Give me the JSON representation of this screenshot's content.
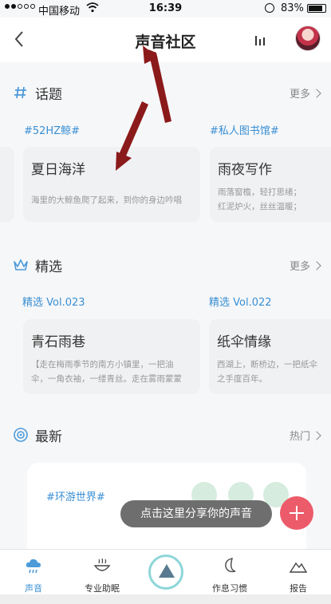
{
  "status_bar": {
    "carrier": "中国移动",
    "time": "16:39",
    "battery": "83%"
  },
  "nav": {
    "title": "声音社区"
  },
  "topics": {
    "title": "话题",
    "more": "更多",
    "cards": [
      {
        "tag": "#52HZ鲸#",
        "title": "夏日海洋",
        "desc": "海里的大鲸鱼爬了起来，到你的身边吟唱"
      },
      {
        "tag": "#私人图书馆#",
        "title": "雨夜写作",
        "desc_lines": [
          "雨落窗檐，轻打思绪；",
          "红泥炉火，丝丝温暖；"
        ]
      }
    ]
  },
  "featured": {
    "title": "精选",
    "more": "更多",
    "cards": [
      {
        "tag": "精选 Vol.023",
        "title": "青石雨巷",
        "desc_lines": [
          "【走在梅雨季节的南方小镇里，一把油",
          "伞，一角衣袖，一缕青丝。走在雾雨蒙蒙"
        ]
      },
      {
        "tag": "精选 Vol.022",
        "title": "纸伞情缘",
        "desc_lines": [
          "西湖上，断桥边，一把纸伞",
          "之手度百年。"
        ]
      }
    ]
  },
  "latest": {
    "title": "最新",
    "sort": "热门",
    "card_tag": "#环游世界#"
  },
  "share_tip": "点击这里分享你的声音",
  "tabs": [
    {
      "label": "声音",
      "active": true
    },
    {
      "label": "专业助眠",
      "active": false
    },
    {
      "label": "作息习惯",
      "active": false
    },
    {
      "label": "报告",
      "active": false
    }
  ],
  "colors": {
    "accent": "#3a8fd4",
    "fab": "#ec5b6a",
    "annotation": "#8b1a1a"
  }
}
